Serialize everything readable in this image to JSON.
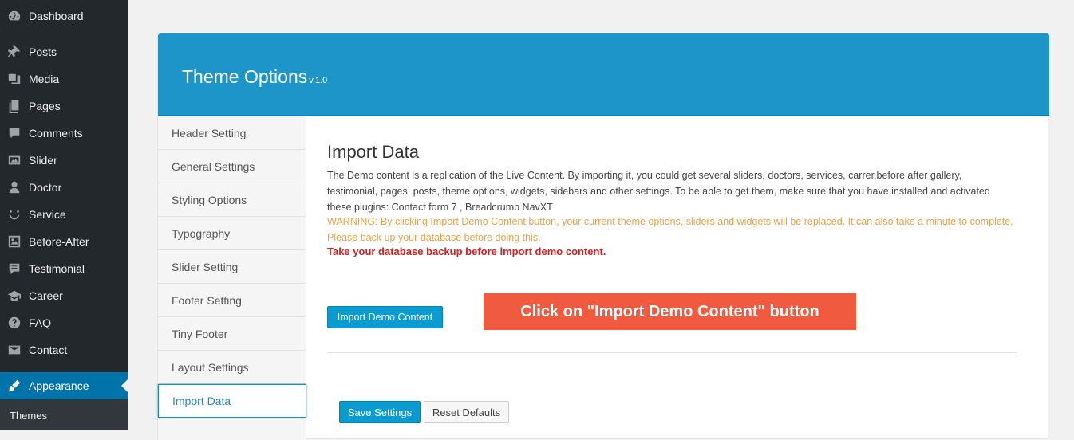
{
  "sidebar": {
    "items": [
      {
        "label": "Dashboard",
        "icon": "dashboard-icon"
      },
      {
        "label": "Posts",
        "icon": "pin-icon"
      },
      {
        "label": "Media",
        "icon": "media-icon"
      },
      {
        "label": "Pages",
        "icon": "pages-icon"
      },
      {
        "label": "Comments",
        "icon": "comment-icon"
      },
      {
        "label": "Slider",
        "icon": "slider-icon"
      },
      {
        "label": "Doctor",
        "icon": "person-icon"
      },
      {
        "label": "Service",
        "icon": "smile-icon"
      },
      {
        "label": "Before-After",
        "icon": "gallery-icon"
      },
      {
        "label": "Testimonial",
        "icon": "testimonial-icon"
      },
      {
        "label": "Career",
        "icon": "graduation-icon"
      },
      {
        "label": "FAQ",
        "icon": "help-icon"
      },
      {
        "label": "Contact",
        "icon": "mail-icon"
      },
      {
        "label": "Appearance",
        "icon": "brush-icon"
      }
    ],
    "submenu": [
      "Themes"
    ]
  },
  "panel": {
    "title": "Theme Options",
    "version": "v.1.0"
  },
  "tabs": [
    "Header Setting",
    "General Settings",
    "Styling Options",
    "Typography",
    "Slider Setting",
    "Footer Setting",
    "Tiny Footer",
    "Layout Settings",
    "Import Data"
  ],
  "content": {
    "title": "Import Data",
    "description": "The Demo content is a replication of the Live Content. By importing it, you could get several sliders, doctors, services, carrer,before after gallery, testimonial, pages, posts, theme options, widgets, sidebars and other settings. To be able to get them, make sure that you have installed and activated these plugins: Contact form 7 , Breadcrumb NavXT",
    "warning": "WARNING: By clicking Import Demo Content button, your current theme options, sliders and widgets will be replaced. It can also take a minute to complete. Please back up your database before doing this.",
    "backup_note": "Take your database backup before import demo content.",
    "import_button": "Import Demo Content",
    "callout": "Click on \"Import Demo Content\" button",
    "save_button": "Save Settings",
    "reset_button": "Reset Defaults"
  },
  "colors": {
    "sidebar_bg": "#23282d",
    "accent": "#0073aa",
    "header_blue": "#1e95c9",
    "warning": "#e8a34a",
    "danger": "#dd1c1c",
    "callout": "#f05b40"
  }
}
